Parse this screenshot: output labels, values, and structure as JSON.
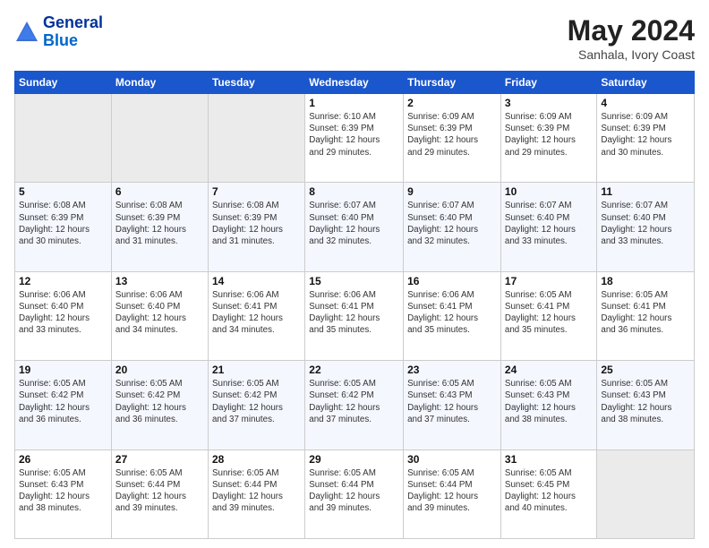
{
  "header": {
    "logo_line1": "General",
    "logo_line2": "Blue",
    "month_title": "May 2024",
    "subtitle": "Sanhala, Ivory Coast"
  },
  "days_of_week": [
    "Sunday",
    "Monday",
    "Tuesday",
    "Wednesday",
    "Thursday",
    "Friday",
    "Saturday"
  ],
  "weeks": [
    [
      {
        "day": "",
        "info": ""
      },
      {
        "day": "",
        "info": ""
      },
      {
        "day": "",
        "info": ""
      },
      {
        "day": "1",
        "info": "Sunrise: 6:10 AM\nSunset: 6:39 PM\nDaylight: 12 hours\nand 29 minutes."
      },
      {
        "day": "2",
        "info": "Sunrise: 6:09 AM\nSunset: 6:39 PM\nDaylight: 12 hours\nand 29 minutes."
      },
      {
        "day": "3",
        "info": "Sunrise: 6:09 AM\nSunset: 6:39 PM\nDaylight: 12 hours\nand 29 minutes."
      },
      {
        "day": "4",
        "info": "Sunrise: 6:09 AM\nSunset: 6:39 PM\nDaylight: 12 hours\nand 30 minutes."
      }
    ],
    [
      {
        "day": "5",
        "info": "Sunrise: 6:08 AM\nSunset: 6:39 PM\nDaylight: 12 hours\nand 30 minutes."
      },
      {
        "day": "6",
        "info": "Sunrise: 6:08 AM\nSunset: 6:39 PM\nDaylight: 12 hours\nand 31 minutes."
      },
      {
        "day": "7",
        "info": "Sunrise: 6:08 AM\nSunset: 6:39 PM\nDaylight: 12 hours\nand 31 minutes."
      },
      {
        "day": "8",
        "info": "Sunrise: 6:07 AM\nSunset: 6:40 PM\nDaylight: 12 hours\nand 32 minutes."
      },
      {
        "day": "9",
        "info": "Sunrise: 6:07 AM\nSunset: 6:40 PM\nDaylight: 12 hours\nand 32 minutes."
      },
      {
        "day": "10",
        "info": "Sunrise: 6:07 AM\nSunset: 6:40 PM\nDaylight: 12 hours\nand 33 minutes."
      },
      {
        "day": "11",
        "info": "Sunrise: 6:07 AM\nSunset: 6:40 PM\nDaylight: 12 hours\nand 33 minutes."
      }
    ],
    [
      {
        "day": "12",
        "info": "Sunrise: 6:06 AM\nSunset: 6:40 PM\nDaylight: 12 hours\nand 33 minutes."
      },
      {
        "day": "13",
        "info": "Sunrise: 6:06 AM\nSunset: 6:40 PM\nDaylight: 12 hours\nand 34 minutes."
      },
      {
        "day": "14",
        "info": "Sunrise: 6:06 AM\nSunset: 6:41 PM\nDaylight: 12 hours\nand 34 minutes."
      },
      {
        "day": "15",
        "info": "Sunrise: 6:06 AM\nSunset: 6:41 PM\nDaylight: 12 hours\nand 35 minutes."
      },
      {
        "day": "16",
        "info": "Sunrise: 6:06 AM\nSunset: 6:41 PM\nDaylight: 12 hours\nand 35 minutes."
      },
      {
        "day": "17",
        "info": "Sunrise: 6:05 AM\nSunset: 6:41 PM\nDaylight: 12 hours\nand 35 minutes."
      },
      {
        "day": "18",
        "info": "Sunrise: 6:05 AM\nSunset: 6:41 PM\nDaylight: 12 hours\nand 36 minutes."
      }
    ],
    [
      {
        "day": "19",
        "info": "Sunrise: 6:05 AM\nSunset: 6:42 PM\nDaylight: 12 hours\nand 36 minutes."
      },
      {
        "day": "20",
        "info": "Sunrise: 6:05 AM\nSunset: 6:42 PM\nDaylight: 12 hours\nand 36 minutes."
      },
      {
        "day": "21",
        "info": "Sunrise: 6:05 AM\nSunset: 6:42 PM\nDaylight: 12 hours\nand 37 minutes."
      },
      {
        "day": "22",
        "info": "Sunrise: 6:05 AM\nSunset: 6:42 PM\nDaylight: 12 hours\nand 37 minutes."
      },
      {
        "day": "23",
        "info": "Sunrise: 6:05 AM\nSunset: 6:43 PM\nDaylight: 12 hours\nand 37 minutes."
      },
      {
        "day": "24",
        "info": "Sunrise: 6:05 AM\nSunset: 6:43 PM\nDaylight: 12 hours\nand 38 minutes."
      },
      {
        "day": "25",
        "info": "Sunrise: 6:05 AM\nSunset: 6:43 PM\nDaylight: 12 hours\nand 38 minutes."
      }
    ],
    [
      {
        "day": "26",
        "info": "Sunrise: 6:05 AM\nSunset: 6:43 PM\nDaylight: 12 hours\nand 38 minutes."
      },
      {
        "day": "27",
        "info": "Sunrise: 6:05 AM\nSunset: 6:44 PM\nDaylight: 12 hours\nand 39 minutes."
      },
      {
        "day": "28",
        "info": "Sunrise: 6:05 AM\nSunset: 6:44 PM\nDaylight: 12 hours\nand 39 minutes."
      },
      {
        "day": "29",
        "info": "Sunrise: 6:05 AM\nSunset: 6:44 PM\nDaylight: 12 hours\nand 39 minutes."
      },
      {
        "day": "30",
        "info": "Sunrise: 6:05 AM\nSunset: 6:44 PM\nDaylight: 12 hours\nand 39 minutes."
      },
      {
        "day": "31",
        "info": "Sunrise: 6:05 AM\nSunset: 6:45 PM\nDaylight: 12 hours\nand 40 minutes."
      },
      {
        "day": "",
        "info": ""
      }
    ]
  ]
}
